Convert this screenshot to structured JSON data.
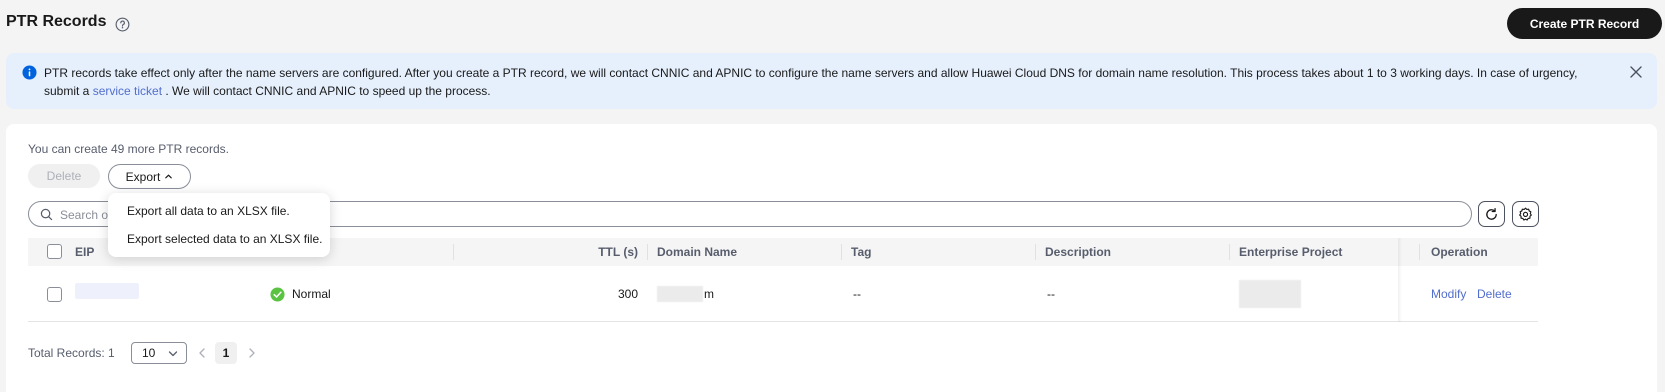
{
  "header": {
    "title": "PTR Records",
    "create_button": "Create PTR Record"
  },
  "alert": {
    "text_before_link": "PTR records take effect only after the name servers are configured. After you create a PTR record, we will contact CNNIC and APNIC to configure the name servers and allow Huawei Cloud DNS for domain name resolution. This process takes about 1 to 3 working days. In case of urgency, submit a ",
    "link": "service ticket",
    "text_after_link": " . We will contact CNNIC and APNIC to speed up the process."
  },
  "quota_text": "You can create 49 more PTR records.",
  "toolbar": {
    "delete_label": "Delete",
    "export_label": "Export"
  },
  "search": {
    "placeholder": "Search or"
  },
  "export_menu": [
    "Export all data to an XLSX file.",
    "Export selected data to an XLSX file."
  ],
  "table": {
    "columns": [
      "EIP",
      "TTL (s)",
      "Domain Name",
      "Tag",
      "Description",
      "Enterprise Project",
      "Operation"
    ],
    "rows": [
      {
        "eip": "",
        "status": "Normal",
        "ttl": "300",
        "domain_suffix": "m",
        "tag": "--",
        "description": "--",
        "enterprise_project": "",
        "ops": [
          "Modify",
          "Delete"
        ]
      }
    ]
  },
  "pagination": {
    "total_label": "Total Records: 1",
    "page_size": "10",
    "current_page": "1"
  },
  "colors": {
    "primary_dark": "#191919",
    "link": "#526ecc",
    "alert_bg": "#e6f0fd",
    "info_blue": "#0062dc",
    "status_green": "#5ac342"
  },
  "icons": [
    "help-icon",
    "info-icon",
    "close-icon",
    "chevron-up-icon",
    "search-icon",
    "refresh-icon",
    "gear-icon",
    "check-circle-icon",
    "chevron-down-icon",
    "chevron-left-icon",
    "chevron-right-icon"
  ]
}
